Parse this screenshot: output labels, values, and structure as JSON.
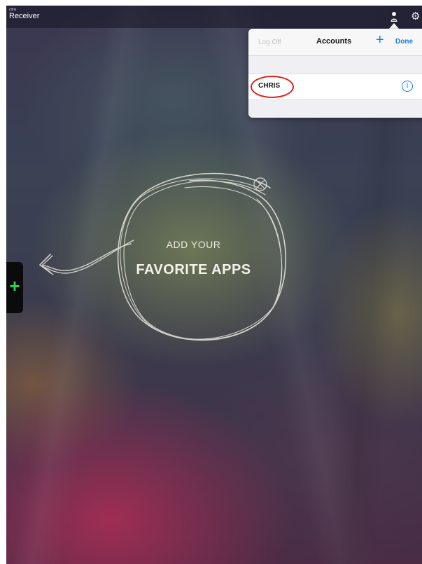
{
  "app": {
    "brand_small": "citrix",
    "title": "Receiver"
  },
  "toolbar": {
    "account_icon": "person-icon",
    "settings_icon": "gear-icon",
    "settings_glyph": "⚙"
  },
  "accounts_popover": {
    "log_off_label": "Log Off",
    "title": "Accounts",
    "add_glyph": "+",
    "done_label": "Done",
    "accounts": [
      {
        "name": "CHRIS",
        "info_glyph": "i",
        "highlighted": true
      }
    ]
  },
  "empty_state": {
    "line1": "ADD YOUR",
    "line2": "FAVORITE APPS",
    "close_icon": "close-icon"
  },
  "side_panel": {
    "add_glyph": "+"
  },
  "colors": {
    "accent": "#1a7ae8",
    "highlight_ring": "#e02020",
    "add_green": "#35d04f"
  }
}
